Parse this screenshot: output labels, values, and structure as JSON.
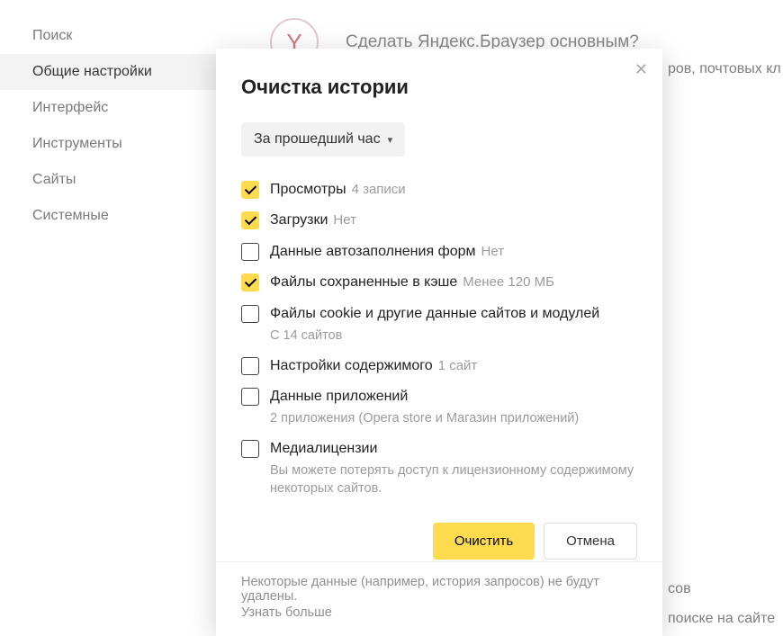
{
  "sidebar": {
    "items": [
      {
        "label": "Поиск",
        "active": false
      },
      {
        "label": "Общие настройки",
        "active": true
      },
      {
        "label": "Интерфейс",
        "active": false
      },
      {
        "label": "Инструменты",
        "active": false
      },
      {
        "label": "Сайты",
        "active": false
      },
      {
        "label": "Системные",
        "active": false
      }
    ]
  },
  "promo": {
    "title": "Сделать Яндекс.Браузер основным?",
    "icon_glyph": "Y"
  },
  "bg": {
    "line1": "ров, почтовых кл",
    "line2": "сов",
    "line3": "поиске на сайте"
  },
  "modal": {
    "title": "Очистка истории",
    "time_select": {
      "label": "За прошедший час"
    },
    "options": [
      {
        "checked": true,
        "label": "Просмотры",
        "hint": "4 записи",
        "sub": ""
      },
      {
        "checked": true,
        "label": "Загрузки",
        "hint": "Нет",
        "sub": ""
      },
      {
        "checked": false,
        "label": "Данные автозаполнения форм",
        "hint": "Нет",
        "sub": ""
      },
      {
        "checked": true,
        "label": "Файлы сохраненные в кэше",
        "hint": "Менее 120 МБ",
        "sub": ""
      },
      {
        "checked": false,
        "label": "Файлы cookie и другие данные сайтов и модулей",
        "hint": "",
        "sub": "С 14 сайтов"
      },
      {
        "checked": false,
        "label": "Настройки содержимого",
        "hint": "1 сайт",
        "sub": ""
      },
      {
        "checked": false,
        "label": "Данные приложений",
        "hint": "",
        "sub": "2 приложения (Opera store и Магазин приложений)"
      },
      {
        "checked": false,
        "label": "Медиалицензии",
        "hint": "",
        "sub": "Вы можете потерять доступ к лицензионному содержимому некоторых сайтов."
      }
    ],
    "buttons": {
      "primary": "Очистить",
      "secondary": "Отмена"
    },
    "footer": {
      "text": "Некоторые данные (например, история запросов) не будут удалены.",
      "link": "Узнать больше"
    }
  }
}
